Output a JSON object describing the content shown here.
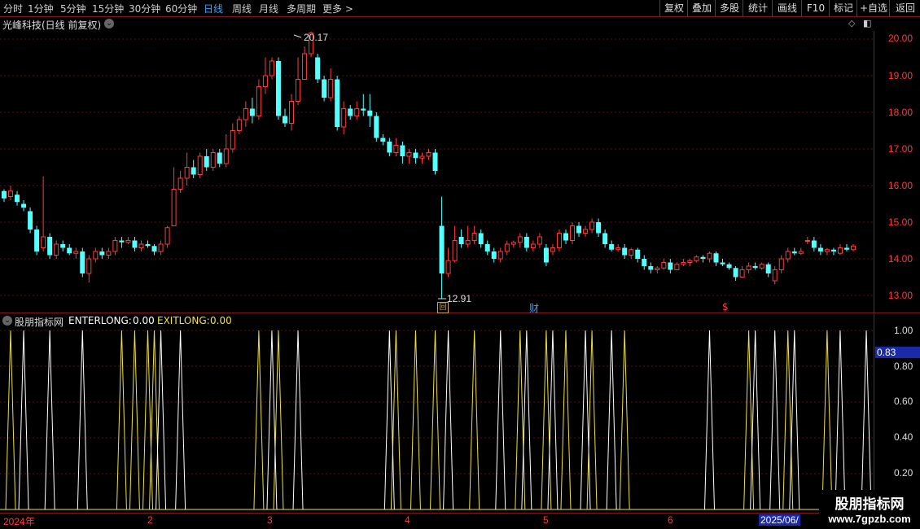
{
  "toolbar": {
    "periods": [
      "分时",
      "1分钟",
      "5分钟",
      "15分钟",
      "30分钟",
      "60分钟",
      "日线",
      "周线",
      "月线",
      "多周期",
      "更多 >"
    ],
    "active_period": "日线",
    "right_buttons": [
      "复权",
      "叠加",
      "多股",
      "统计",
      "画线",
      "F10",
      "标记",
      "+自选",
      "返回"
    ]
  },
  "stock": {
    "title": "光峰科技(日线 前复权)",
    "high_label": "20.17",
    "low_label": "12.91",
    "markers": [
      "回",
      "财",
      "$"
    ]
  },
  "price_axis": [
    "20.00",
    "19.00",
    "18.00",
    "17.00",
    "16.00",
    "15.00",
    "14.00",
    "13.00"
  ],
  "indicator": {
    "name": "股朋指标网",
    "enter_label": "ENTERLONG:",
    "enter_value": "0.00",
    "exit_label": "EXITLONG:",
    "exit_value": "0.00",
    "axis": [
      "1.00",
      "0.80",
      "0.60",
      "0.40",
      "0.20"
    ],
    "current_value": "0.83"
  },
  "date_axis": [
    "2024年",
    "2",
    "3",
    "4",
    "5",
    "6",
    "2025/06/"
  ],
  "watermark": {
    "brand": "股朋指标网",
    "url": "www.7gpzb.com"
  },
  "colors": {
    "up": "#ff3b3b",
    "down": "#54ffff",
    "grid": "#5a0f0f",
    "enter": "#ffffff",
    "exit": "#f0e040"
  },
  "chart_data": {
    "type": "candlestick",
    "title": "光峰科技(日线 前复权)",
    "ylim": [
      12.7,
      20.5
    ],
    "candles": [
      [
        15.85,
        15.65,
        15.9,
        15.55
      ],
      [
        15.7,
        15.85,
        16.0,
        15.6
      ],
      [
        15.75,
        15.55,
        15.85,
        15.45
      ],
      [
        15.5,
        15.4,
        15.6,
        15.3
      ],
      [
        15.3,
        14.8,
        15.4,
        14.7
      ],
      [
        14.8,
        14.2,
        14.9,
        14.1
      ],
      [
        14.3,
        14.6,
        16.25,
        14.2
      ],
      [
        14.6,
        14.1,
        14.7,
        14.0
      ],
      [
        14.1,
        14.4,
        14.5,
        14.0
      ],
      [
        14.4,
        14.3,
        14.5,
        14.2
      ],
      [
        14.3,
        14.15,
        14.4,
        14.1
      ],
      [
        14.15,
        14.2,
        14.3,
        14.0
      ],
      [
        14.2,
        13.6,
        14.3,
        13.5
      ],
      [
        13.6,
        14.0,
        14.1,
        13.35
      ],
      [
        14.0,
        14.2,
        14.3,
        13.9
      ],
      [
        14.2,
        14.1,
        14.3,
        14.0
      ],
      [
        14.1,
        14.2,
        14.3,
        14.0
      ],
      [
        14.2,
        14.5,
        14.6,
        14.1
      ],
      [
        14.5,
        14.45,
        14.6,
        14.3
      ],
      [
        14.45,
        14.5,
        14.6,
        14.4
      ],
      [
        14.5,
        14.3,
        14.6,
        14.2
      ],
      [
        14.3,
        14.4,
        14.5,
        14.2
      ],
      [
        14.4,
        14.35,
        14.5,
        14.3
      ],
      [
        14.35,
        14.2,
        14.4,
        14.1
      ],
      [
        14.2,
        14.4,
        14.5,
        14.1
      ],
      [
        14.4,
        14.85,
        14.9,
        14.3
      ],
      [
        14.9,
        15.9,
        16.5,
        14.9
      ],
      [
        15.9,
        16.2,
        16.4,
        15.8
      ],
      [
        16.2,
        16.5,
        16.9,
        16.0
      ],
      [
        16.5,
        16.3,
        16.7,
        16.2
      ],
      [
        16.3,
        16.8,
        16.9,
        16.2
      ],
      [
        16.8,
        16.5,
        17.0,
        16.4
      ],
      [
        16.5,
        16.9,
        17.0,
        16.4
      ],
      [
        16.9,
        16.6,
        17.0,
        16.5
      ],
      [
        16.6,
        17.0,
        17.4,
        16.5
      ],
      [
        17.0,
        17.5,
        17.7,
        16.9
      ],
      [
        17.5,
        17.8,
        17.9,
        17.4
      ],
      [
        17.8,
        18.1,
        18.3,
        17.6
      ],
      [
        18.1,
        17.9,
        18.4,
        17.7
      ],
      [
        17.9,
        18.7,
        18.9,
        17.8
      ],
      [
        18.7,
        19.0,
        19.5,
        18.5
      ],
      [
        19.0,
        19.4,
        19.5,
        18.9
      ],
      [
        19.4,
        17.9,
        19.5,
        17.8
      ],
      [
        17.9,
        17.7,
        18.1,
        17.6
      ],
      [
        17.7,
        18.3,
        18.5,
        17.5
      ],
      [
        18.3,
        18.9,
        19.5,
        18.2
      ],
      [
        18.9,
        19.6,
        19.8,
        18.9
      ],
      [
        19.6,
        20.17,
        20.2,
        19.5
      ],
      [
        19.5,
        18.9,
        19.6,
        18.8
      ],
      [
        18.9,
        18.4,
        19.0,
        18.3
      ],
      [
        18.4,
        18.9,
        19.2,
        18.3
      ],
      [
        18.9,
        17.6,
        19.0,
        17.5
      ],
      [
        17.6,
        18.1,
        18.3,
        17.4
      ],
      [
        18.1,
        17.9,
        18.2,
        17.8
      ],
      [
        17.9,
        18.1,
        18.3,
        17.8
      ],
      [
        18.1,
        18.05,
        18.5,
        17.9
      ],
      [
        18.05,
        17.9,
        18.5,
        17.6
      ],
      [
        17.9,
        17.3,
        18.0,
        17.2
      ],
      [
        17.3,
        17.2,
        17.4,
        17.1
      ],
      [
        17.2,
        16.9,
        17.3,
        16.8
      ],
      [
        16.9,
        17.1,
        17.3,
        16.8
      ],
      [
        17.1,
        16.8,
        17.2,
        16.6
      ],
      [
        16.8,
        16.9,
        17.0,
        16.6
      ],
      [
        16.9,
        16.75,
        17.0,
        16.6
      ],
      [
        16.75,
        16.8,
        16.9,
        16.6
      ],
      [
        16.8,
        16.9,
        17.0,
        16.7
      ],
      [
        16.9,
        16.4,
        17.0,
        16.3
      ],
      [
        14.9,
        13.6,
        15.7,
        12.91
      ],
      [
        13.6,
        13.95,
        14.3,
        13.5
      ],
      [
        13.95,
        14.5,
        14.9,
        13.9
      ],
      [
        14.6,
        14.4,
        14.8,
        14.3
      ],
      [
        14.4,
        14.5,
        14.9,
        14.3
      ],
      [
        14.5,
        14.7,
        14.9,
        14.4
      ],
      [
        14.7,
        14.4,
        14.8,
        14.3
      ],
      [
        14.4,
        14.2,
        14.5,
        14.1
      ],
      [
        14.2,
        14.0,
        14.3,
        13.9
      ],
      [
        14.0,
        14.2,
        14.3,
        13.9
      ],
      [
        14.2,
        14.4,
        14.5,
        14.1
      ],
      [
        14.4,
        14.45,
        14.5,
        14.3
      ],
      [
        14.45,
        14.6,
        14.7,
        14.3
      ],
      [
        14.6,
        14.3,
        14.7,
        14.2
      ],
      [
        14.3,
        14.4,
        14.5,
        14.2
      ],
      [
        14.4,
        14.6,
        14.7,
        14.3
      ],
      [
        14.3,
        13.9,
        14.4,
        13.8
      ],
      [
        14.2,
        14.3,
        14.4,
        14.1
      ],
      [
        14.3,
        14.7,
        14.8,
        14.2
      ],
      [
        14.7,
        14.5,
        14.8,
        14.4
      ],
      [
        14.5,
        14.9,
        15.0,
        14.4
      ],
      [
        14.9,
        14.7,
        15.0,
        14.6
      ],
      [
        14.7,
        14.8,
        14.9,
        14.6
      ],
      [
        14.8,
        15.0,
        15.1,
        14.7
      ],
      [
        15.0,
        14.7,
        15.1,
        14.6
      ],
      [
        14.7,
        14.4,
        14.8,
        14.3
      ],
      [
        14.4,
        14.25,
        14.5,
        14.2
      ],
      [
        14.25,
        14.3,
        14.4,
        14.2
      ],
      [
        14.3,
        14.1,
        14.4,
        14.0
      ],
      [
        14.1,
        14.25,
        14.3,
        14.0
      ],
      [
        14.25,
        14.0,
        14.3,
        13.9
      ],
      [
        14.0,
        13.8,
        14.1,
        13.7
      ],
      [
        13.8,
        13.7,
        13.9,
        13.6
      ],
      [
        13.7,
        13.75,
        13.8,
        13.6
      ],
      [
        13.75,
        13.9,
        14.0,
        13.7
      ],
      [
        13.9,
        13.7,
        14.0,
        13.6
      ],
      [
        13.7,
        13.85,
        13.9,
        13.7
      ],
      [
        13.85,
        13.9,
        14.0,
        13.8
      ],
      [
        13.9,
        13.95,
        14.0,
        13.8
      ],
      [
        13.95,
        14.05,
        14.1,
        13.9
      ],
      [
        14.05,
        14.0,
        14.1,
        13.9
      ],
      [
        14.0,
        14.15,
        14.2,
        13.9
      ],
      [
        14.15,
        13.9,
        14.2,
        13.8
      ],
      [
        13.9,
        13.85,
        14.0,
        13.8
      ],
      [
        13.85,
        13.75,
        13.9,
        13.7
      ],
      [
        13.75,
        13.5,
        13.8,
        13.4
      ],
      [
        13.5,
        13.7,
        13.8,
        13.5
      ],
      [
        13.7,
        13.8,
        13.9,
        13.6
      ],
      [
        13.8,
        13.75,
        13.9,
        13.7
      ],
      [
        13.75,
        13.85,
        13.9,
        13.7
      ],
      [
        13.85,
        13.6,
        13.9,
        13.5
      ],
      [
        13.4,
        13.7,
        13.8,
        13.3
      ],
      [
        13.7,
        14.0,
        14.1,
        13.6
      ],
      [
        14.0,
        14.2,
        14.3,
        13.9
      ],
      [
        14.2,
        14.15,
        14.3,
        14.1
      ],
      [
        14.15,
        14.2,
        14.3,
        14.1
      ],
      [
        14.5,
        14.5,
        14.6,
        14.4
      ],
      [
        14.5,
        14.3,
        14.6,
        14.2
      ],
      [
        14.3,
        14.2,
        14.4,
        14.1
      ],
      [
        14.2,
        14.25,
        14.3,
        14.1
      ],
      [
        14.25,
        14.2,
        14.3,
        14.1
      ],
      [
        14.15,
        14.3,
        14.4,
        14.1
      ],
      [
        14.3,
        14.25,
        14.4,
        14.2
      ],
      [
        14.25,
        14.35,
        14.4,
        14.2
      ]
    ],
    "enter_signals": [
      3,
      7,
      12,
      24,
      27,
      41,
      45,
      59,
      68,
      76,
      80,
      84,
      89,
      93,
      108,
      115,
      118,
      121,
      128,
      132
    ],
    "exit_signals": [
      1,
      18,
      20,
      22,
      23,
      39,
      42,
      60,
      63,
      66,
      72,
      79,
      83,
      86,
      90,
      95,
      114,
      120,
      126
    ]
  }
}
